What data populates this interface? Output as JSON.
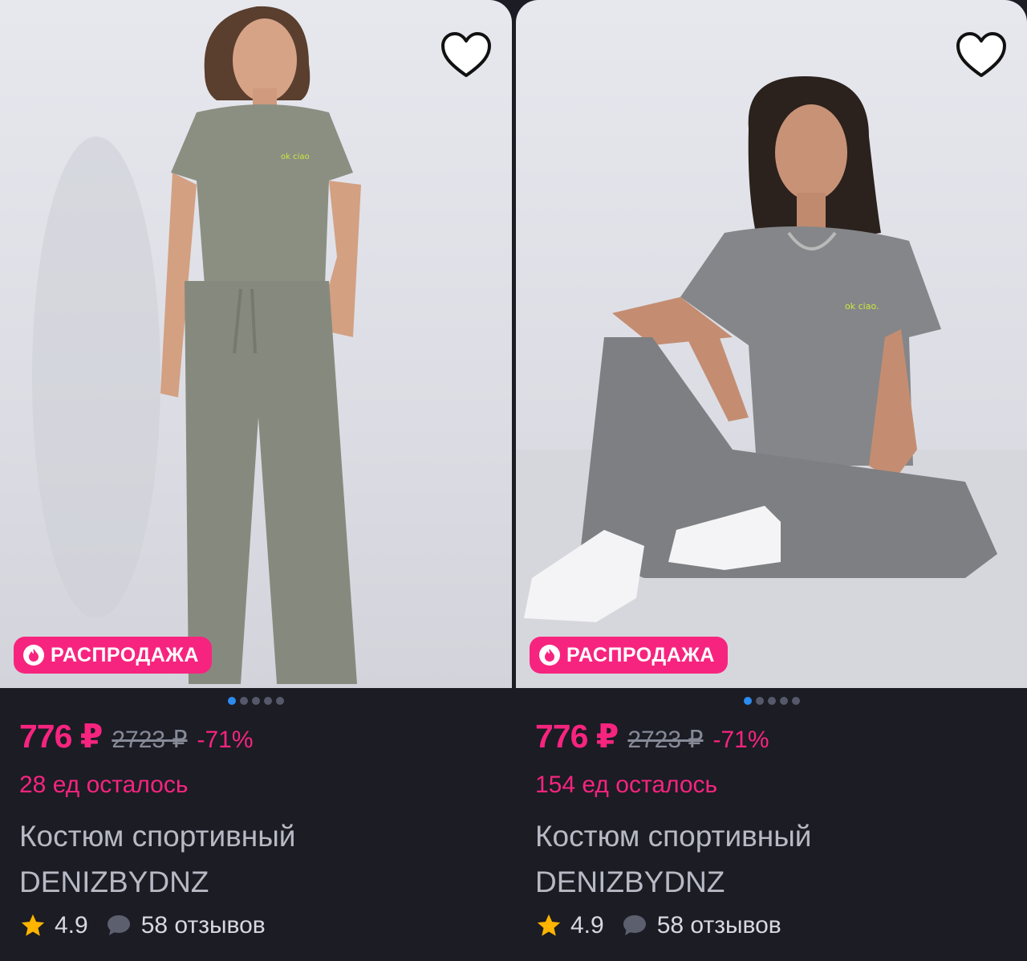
{
  "colors": {
    "accent": "#f7247f",
    "background": "#1b1c24",
    "dot_active": "#2d8cf0"
  },
  "products": [
    {
      "badge": "РАСПРОДАЖА",
      "price": "776 ₽",
      "old_price": "2723 ₽",
      "discount": "-71%",
      "stock": "28 ед осталось",
      "title_line1": "Костюм спортивный",
      "title_line2": "DENIZBYDNZ",
      "rating": "4.9",
      "reviews": "58 отзывов",
      "image_count": 5,
      "active_image": 1,
      "shirt_print": "ok ciao"
    },
    {
      "badge": "РАСПРОДАЖА",
      "price": "776 ₽",
      "old_price": "2723 ₽",
      "discount": "-71%",
      "stock": "154 ед осталось",
      "title_line1": "Костюм спортивный",
      "title_line2": "DENIZBYDNZ",
      "rating": "4.9",
      "reviews": "58 отзывов",
      "image_count": 5,
      "active_image": 1,
      "shirt_print": "ok ciao."
    }
  ],
  "icons": [
    "heart-icon",
    "fire-icon",
    "star-icon",
    "comment-bubble-icon"
  ]
}
